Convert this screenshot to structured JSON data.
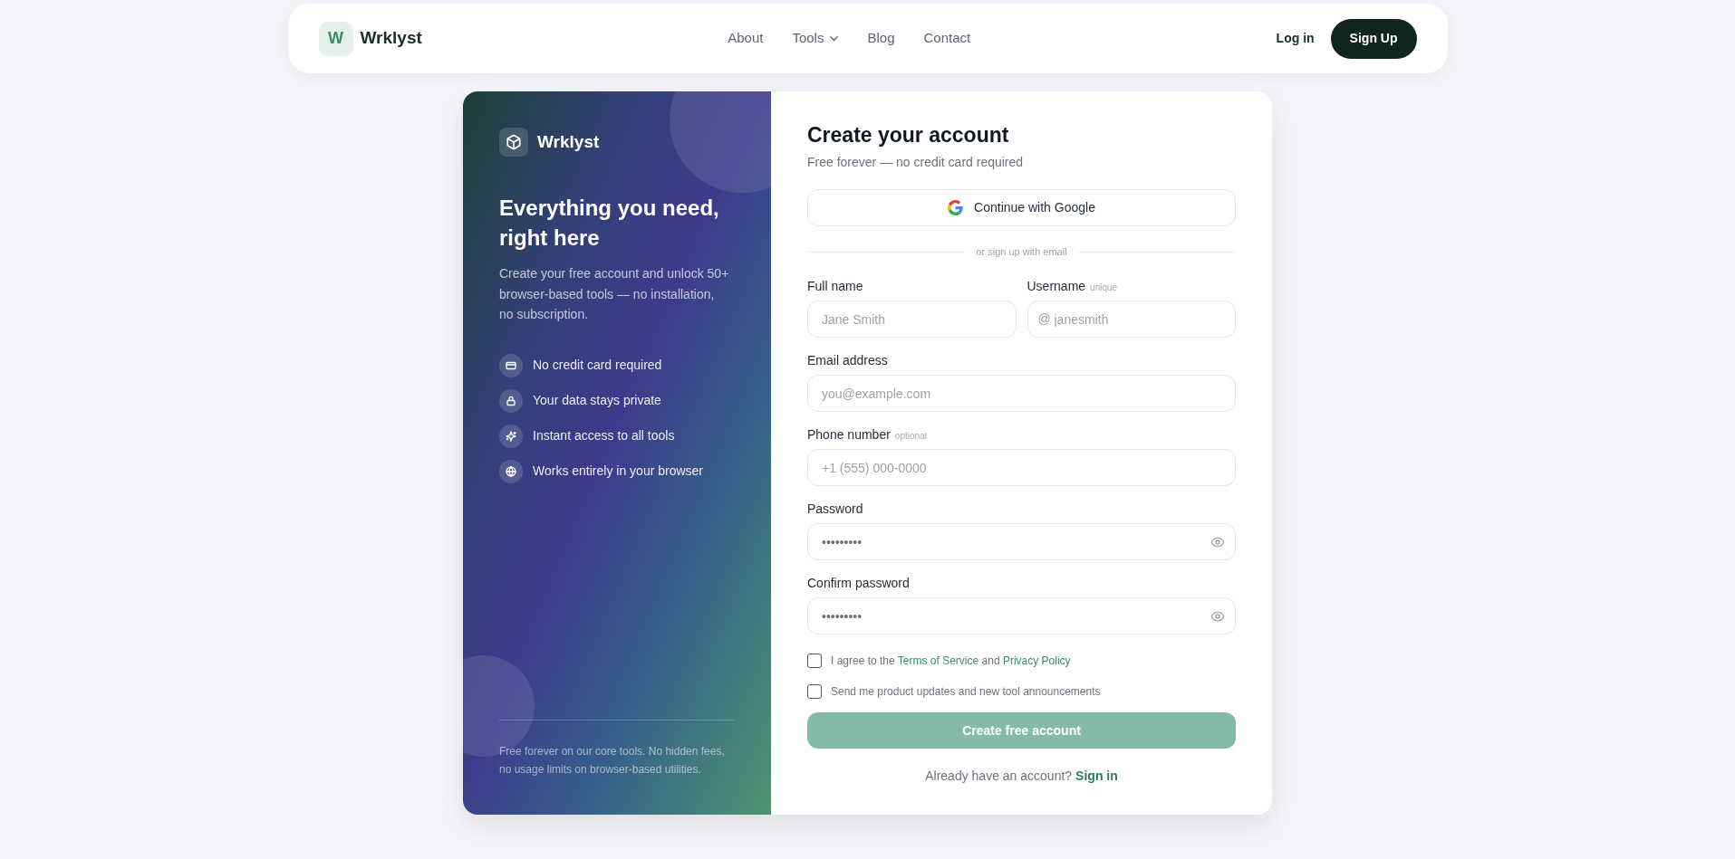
{
  "nav": {
    "logo_letter": "W",
    "brand": "Wrklyst",
    "links": [
      {
        "label": "About",
        "kind": "link"
      },
      {
        "label": "Tools",
        "kind": "dropdown"
      },
      {
        "label": "Blog",
        "kind": "link"
      },
      {
        "label": "Contact",
        "kind": "link"
      }
    ],
    "login": "Log in",
    "signup": "Sign Up"
  },
  "promo": {
    "brand": "Wrklyst",
    "heading": "Everything you need, right here",
    "text": "Create your free account and unlock 50+ browser-based tools — no installation, no subscription.",
    "features": [
      {
        "kind": "card",
        "label": "No credit card required"
      },
      {
        "kind": "lock",
        "label": "Your data stays private"
      },
      {
        "kind": "sparkles",
        "label": "Instant access to all tools"
      },
      {
        "kind": "globe",
        "label": "Works entirely in your browser"
      }
    ],
    "footer": "Free forever on our core tools. No hidden fees, no usage limits on browser-based utilities."
  },
  "form": {
    "title": "Create your account",
    "subtitle": "Free forever — no credit card required",
    "google_button": "Continue with Google",
    "divider": "or sign up with email",
    "rows": [
      [
        {
          "kind": "text",
          "label": "Full name",
          "placeholder": "Jane Smith"
        },
        {
          "kind": "prefixed",
          "label": "Username",
          "hint": "unique",
          "prefix": "@",
          "placeholder": "janesmith"
        }
      ],
      [
        {
          "kind": "text",
          "label": "Email address",
          "placeholder": "you@example.com"
        }
      ],
      [
        {
          "kind": "text",
          "label": "Phone number",
          "hint": "optional",
          "placeholder": "+1 (555) 000-0000"
        }
      ],
      [
        {
          "kind": "password",
          "label": "Password",
          "placeholder": "•••••••••"
        }
      ],
      [
        {
          "kind": "password",
          "label": "Confirm password",
          "placeholder": "•••••••••"
        }
      ]
    ],
    "checkboxes": [
      {
        "checked": false,
        "parts": [
          {
            "kind": "text",
            "text": "I agree to the"
          },
          {
            "kind": "link",
            "text": "Terms of Service"
          },
          {
            "kind": "text",
            "text": "and"
          },
          {
            "kind": "link",
            "text": "Privacy Policy"
          }
        ]
      },
      {
        "checked": false,
        "parts": [
          {
            "kind": "text",
            "text": "Send me product updates and new tool announcements"
          }
        ]
      }
    ],
    "submit": {
      "label": "Create free account",
      "disabled": true
    },
    "signin": {
      "text": "Already have an account?",
      "link": "Sign in"
    }
  }
}
